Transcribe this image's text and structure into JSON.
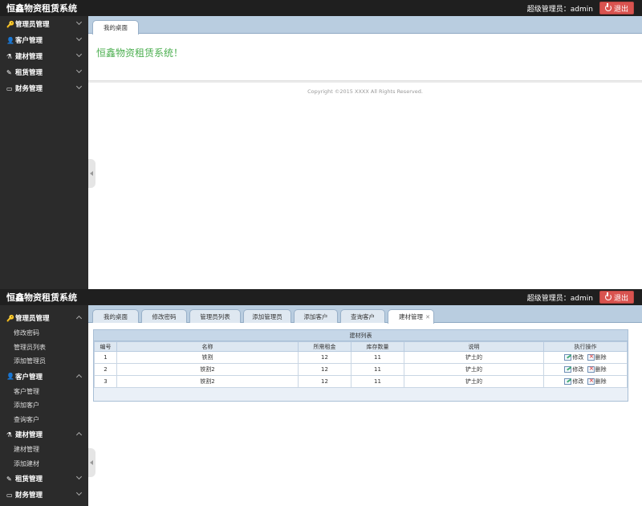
{
  "app_title": "恒鑫物资租赁系统",
  "user_label": "超级管理员：admin",
  "logout_label": "退出",
  "top": {
    "menu": [
      {
        "icon": "key-icon",
        "glyph": "🔑",
        "label": "管理员管理"
      },
      {
        "icon": "user-icon",
        "glyph": "👤",
        "label": "客户管理"
      },
      {
        "icon": "flask-icon",
        "glyph": "⚗",
        "label": "建材管理"
      },
      {
        "icon": "edit-icon",
        "glyph": "✎",
        "label": "租赁管理"
      },
      {
        "icon": "card-icon",
        "glyph": "▭",
        "label": "财务管理"
      }
    ],
    "tab_label": "我的桌面",
    "welcome": "恒鑫物资租赁系统！",
    "copyright": "Copyright ©2015 XXXX All Rights Reserved."
  },
  "bottom": {
    "menu": {
      "admin": {
        "label": "管理员管理",
        "items": [
          "修改密码",
          "管理员列表",
          "添加管理员"
        ]
      },
      "customer": {
        "label": "客户管理",
        "items": [
          "客户管理",
          "添加客户",
          "查询客户"
        ]
      },
      "material": {
        "label": "建材管理",
        "items": [
          "建材管理",
          "添加建材"
        ]
      },
      "rental": {
        "label": "租赁管理"
      },
      "finance": {
        "label": "财务管理"
      }
    },
    "tabs": [
      "我的桌面",
      "修改密码",
      "管理员列表",
      "添加管理员",
      "添加客户",
      "查询客户",
      "建材管理"
    ],
    "table": {
      "caption": "建材列表",
      "headers": [
        "编号",
        "名称",
        "所需租金",
        "库存数量",
        "说明",
        "执行操作"
      ],
      "rows": [
        {
          "id": "1",
          "name": "铁割",
          "rent": "12",
          "stock": "11",
          "desc": "铲土的"
        },
        {
          "id": "2",
          "name": "铁割2",
          "rent": "12",
          "stock": "11",
          "desc": "铲土的"
        },
        {
          "id": "3",
          "name": "铁割2",
          "rent": "12",
          "stock": "11",
          "desc": "铲土的"
        }
      ],
      "edit_label": "修改",
      "delete_label": "删除"
    }
  }
}
